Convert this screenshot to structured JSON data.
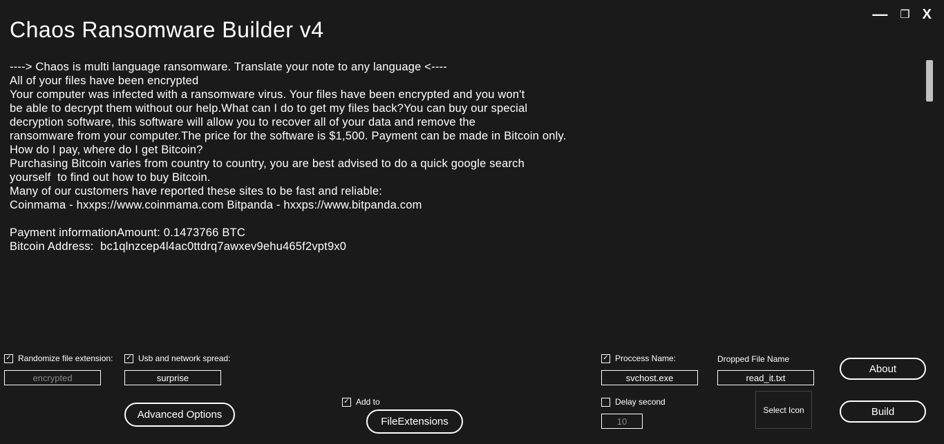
{
  "window": {
    "title": "Chaos Ransomware Builder v4"
  },
  "note": "----> Chaos is multi language ransomware. Translate your note to any language <----\nAll of your files have been encrypted\nYour computer was infected with a ransomware virus. Your files have been encrypted and you won't\nbe able to decrypt them without our help.What can I do to get my files back?You can buy our special\ndecryption software, this software will allow you to recover all of your data and remove the\nransomware from your computer.The price for the software is $1,500. Payment can be made in Bitcoin only.\nHow do I pay, where do I get Bitcoin?\nPurchasing Bitcoin varies from country to country, you are best advised to do a quick google search\nyourself  to find out how to buy Bitcoin.\nMany of our customers have reported these sites to be fast and reliable:\nCoinmama - hxxps://www.coinmama.com Bitpanda - hxxps://www.bitpanda.com\n\nPayment informationAmount: 0.1473766 BTC\nBitcoin Address:  bc1qlnzcep4l4ac0ttdrq7awxev9ehu465f2vpt9x0",
  "options": {
    "randomize_label": "Randomize file extension:",
    "randomize_checked": true,
    "randomize_value": "encrypted",
    "usb_label": "Usb and network spread:",
    "usb_checked": true,
    "usb_value": "surprise",
    "advanced_label": "Advanced Options",
    "addto_label": "Add to",
    "addto_checked": true,
    "file_ext_label": "FileExtensions",
    "process_label": "Proccess Name:",
    "process_checked": true,
    "process_value": "svchost.exe",
    "delay_label": "Delay second",
    "delay_checked": false,
    "delay_value": "10",
    "dropped_label": "Dropped File Name",
    "dropped_value": "read_it.txt",
    "select_icon_label": "Select Icon",
    "about_label": "About",
    "build_label": "Build"
  }
}
